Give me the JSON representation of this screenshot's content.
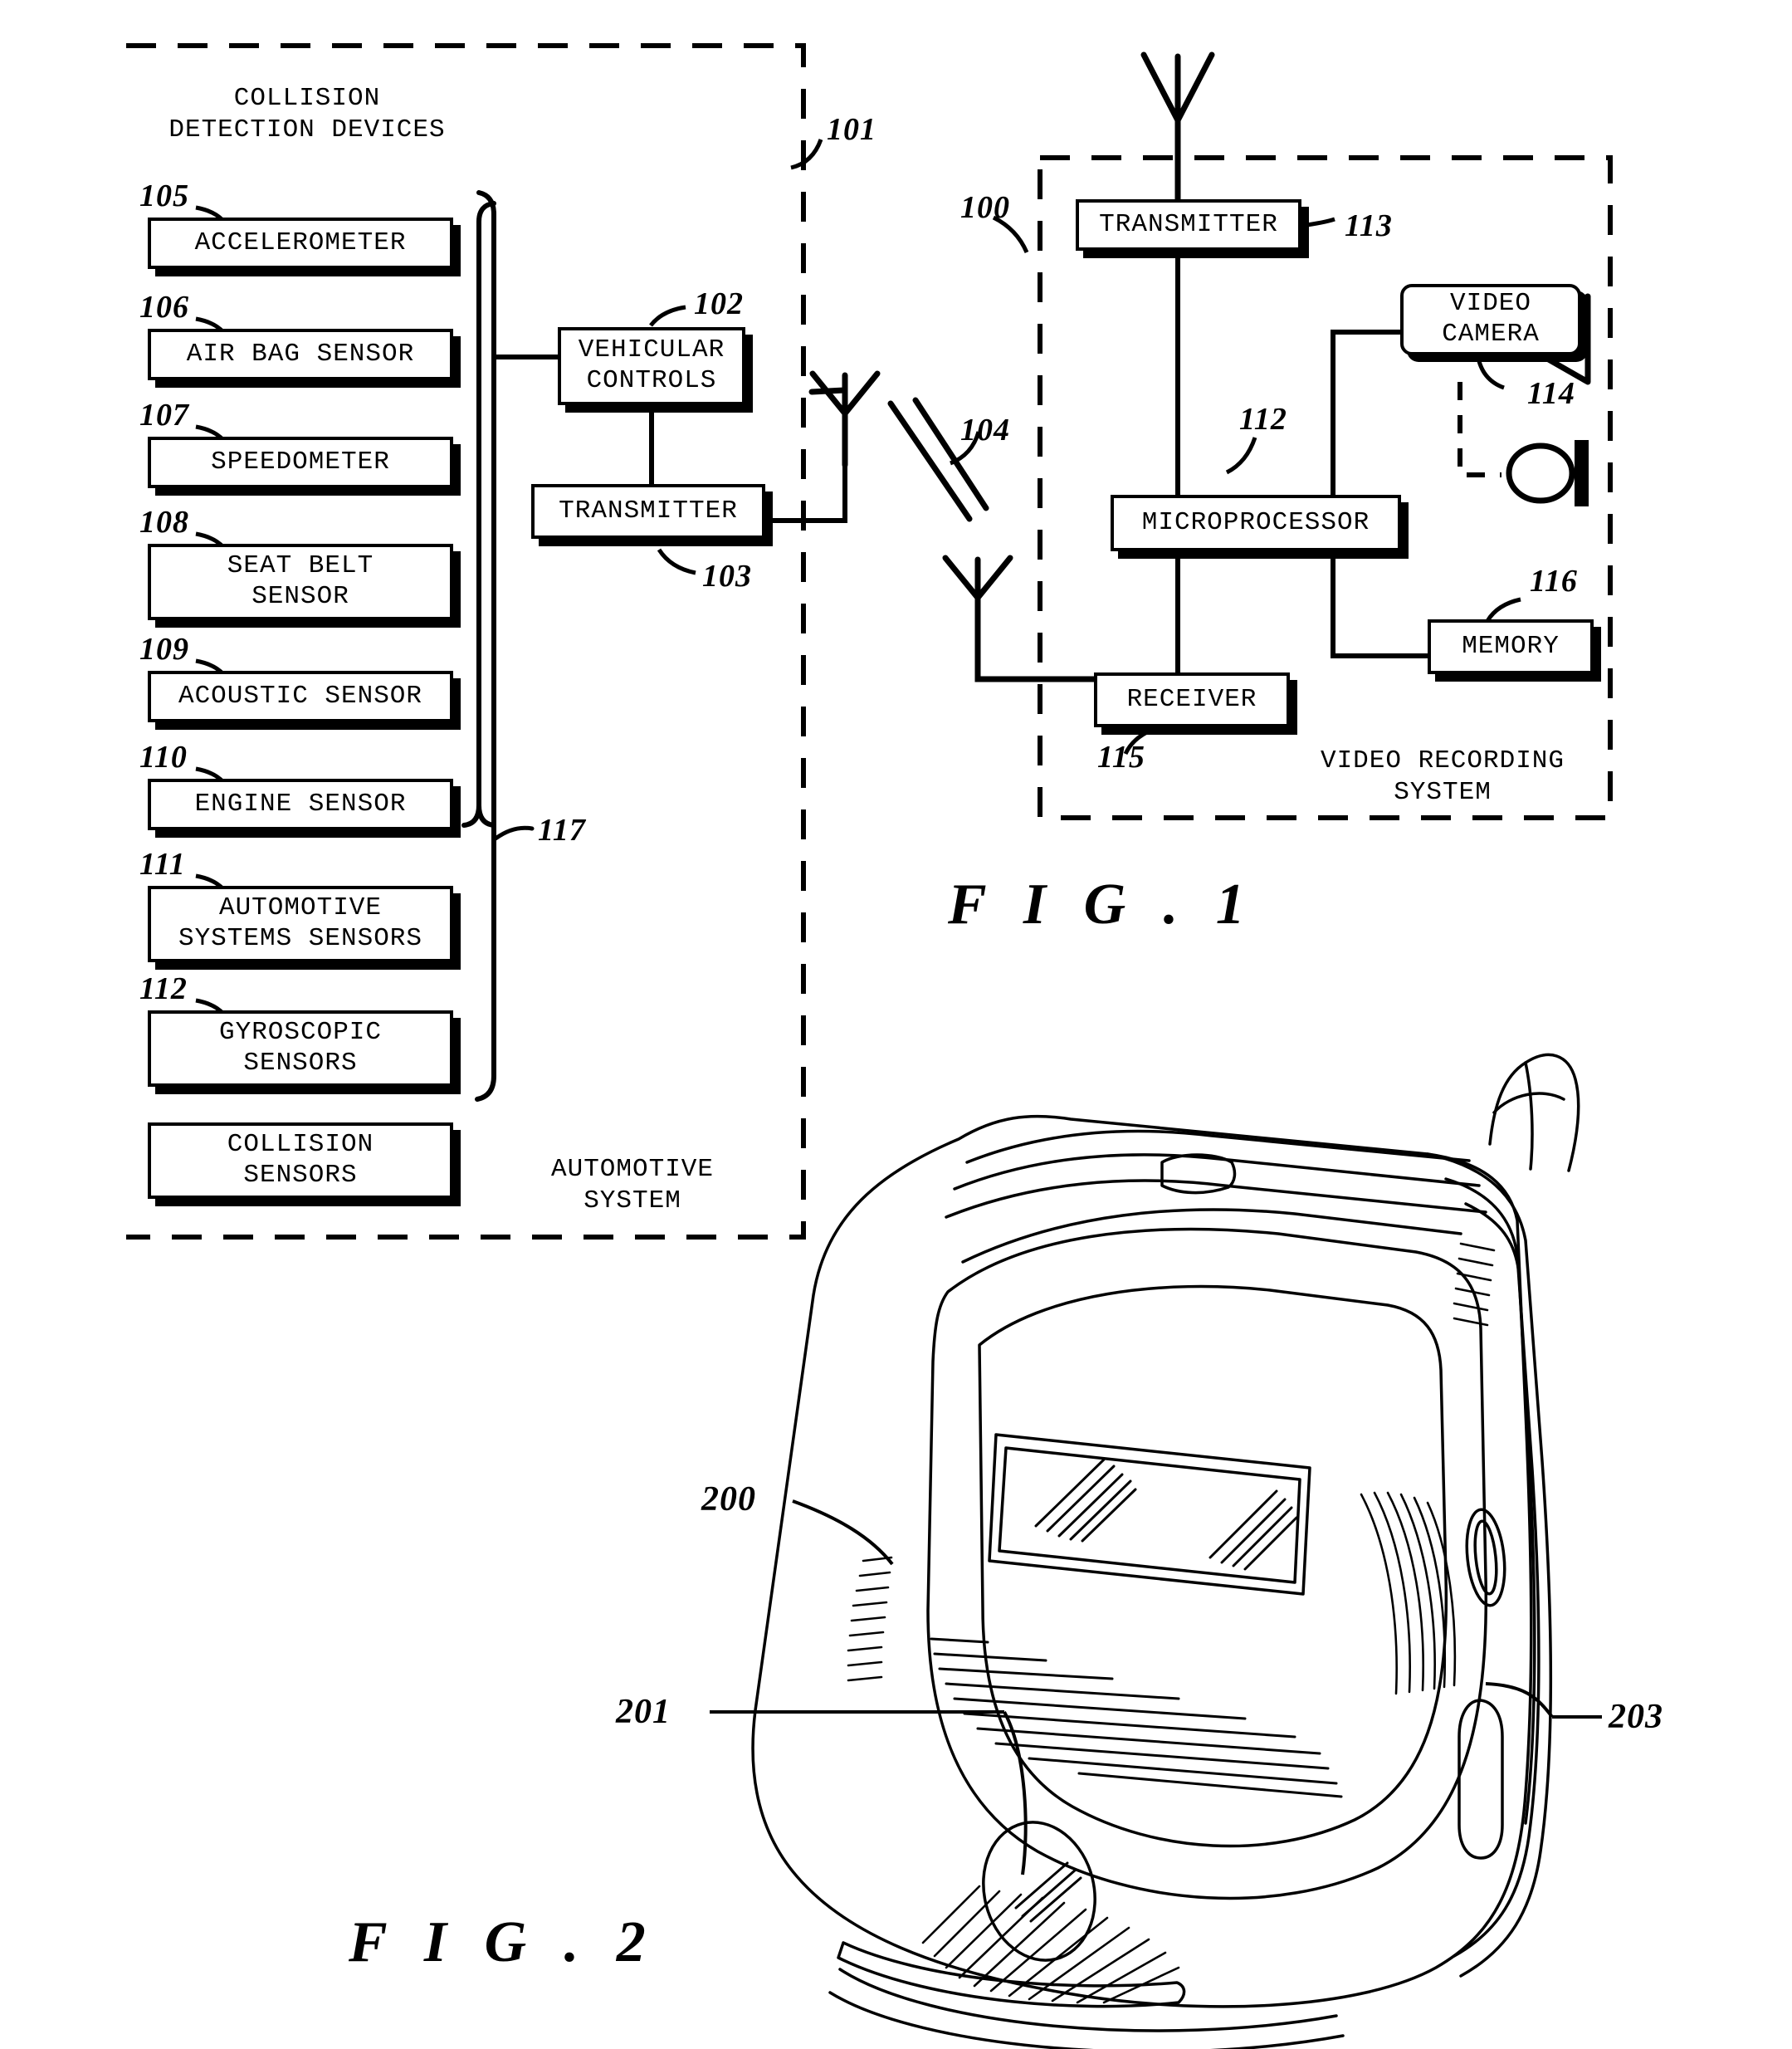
{
  "figure1": {
    "automotive_group_label": "AUTOMOTIVE\nSYSTEM",
    "collision_group_label": "COLLISION\nDETECTION DEVICES",
    "video_group_label": "VIDEO RECORDING\nSYSTEM",
    "sensors": [
      {
        "ref": "105",
        "label": "ACCELEROMETER"
      },
      {
        "ref": "106",
        "label": "AIR BAG SENSOR"
      },
      {
        "ref": "107",
        "label": "SPEEDOMETER"
      },
      {
        "ref": "108",
        "label": "SEAT BELT\nSENSOR"
      },
      {
        "ref": "109",
        "label": "ACOUSTIC SENSOR"
      },
      {
        "ref": "110",
        "label": "ENGINE SENSOR"
      },
      {
        "ref": "111",
        "label": "AUTOMOTIVE\nSYSTEMS SENSORS"
      },
      {
        "ref": "112",
        "label": "GYROSCOPIC\nSENSORS"
      }
    ],
    "collision_sensors_box": {
      "label": "COLLISION\nSENSORS"
    },
    "vehicular_controls": {
      "ref": "102",
      "label": "VEHICULAR\nCONTROLS"
    },
    "vehicle_transmitter": {
      "ref": "103",
      "label": "TRANSMITTER"
    },
    "video_transmitter": {
      "ref": "113",
      "label": "TRANSMITTER"
    },
    "video_camera": {
      "ref": "114",
      "label": "VIDEO\nCAMERA"
    },
    "microprocessor": {
      "ref": "112",
      "label": "MICROPROCESSOR"
    },
    "memory": {
      "ref": "116",
      "label": "MEMORY"
    },
    "receiver": {
      "ref": "115",
      "label": "RECEIVER"
    },
    "refs": {
      "automotive_system_boundary": "101",
      "video_system_boundary": "100",
      "wireless_link": "104",
      "sensor_bracket": "117"
    },
    "title": "F I G .  1"
  },
  "figure2": {
    "title": "F I G .  2",
    "refs": {
      "phone_body": "200",
      "camera_lens": "201",
      "side_key": "203"
    }
  }
}
